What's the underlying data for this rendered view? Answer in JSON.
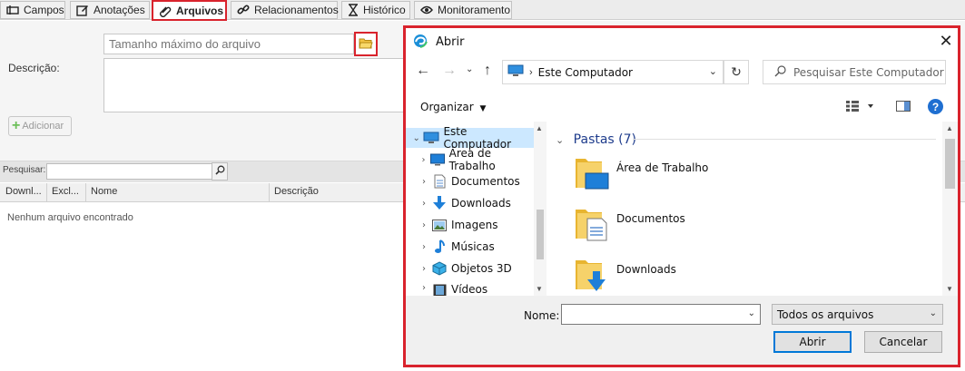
{
  "tabs": [
    {
      "label": "Campos",
      "icon": "field-icon"
    },
    {
      "label": "Anotações",
      "icon": "edit-note-icon"
    },
    {
      "label": "Arquivos",
      "icon": "paperclip-icon",
      "active": true
    },
    {
      "label": "Relacionamentos",
      "icon": "link-icon"
    },
    {
      "label": "Histórico",
      "icon": "hourglass-icon"
    },
    {
      "label": "Monitoramento",
      "icon": "eye-icon"
    }
  ],
  "form": {
    "file_placeholder": "Tamanho máximo do arquivo",
    "description_label": "Descrição:",
    "add_label": "Adicionar"
  },
  "grid": {
    "search_label": "Pesquisar:",
    "columns": [
      "Downl...",
      "Excl...",
      "Nome",
      "Descrição"
    ],
    "empty_message": "Nenhum arquivo encontrado"
  },
  "dialog": {
    "title": "Abrir",
    "close_symbol": "✕",
    "address": "Este Computador",
    "search_placeholder": "Pesquisar Este Computador",
    "organize_label": "Organizar",
    "nav_items": [
      {
        "label": "Este Computador",
        "icon": "computer-icon",
        "expanded": true,
        "selected": true
      },
      {
        "label": "Área de Trabalho",
        "icon": "desktop-icon"
      },
      {
        "label": "Documentos",
        "icon": "documents-icon"
      },
      {
        "label": "Downloads",
        "icon": "downloads-icon"
      },
      {
        "label": "Imagens",
        "icon": "pictures-icon"
      },
      {
        "label": "Músicas",
        "icon": "music-icon"
      },
      {
        "label": "Objetos 3D",
        "icon": "3d-objects-icon"
      },
      {
        "label": "Vídeos",
        "icon": "videos-icon"
      }
    ],
    "group_header": "Pastas (7)",
    "folders": [
      {
        "name": "Área de Trabalho",
        "icon": "desktop-folder-icon"
      },
      {
        "name": "Documentos",
        "icon": "documents-folder-icon"
      },
      {
        "name": "Downloads",
        "icon": "downloads-folder-icon"
      }
    ],
    "name_label": "Nome:",
    "name_value": "",
    "filter_value": "Todos os arquivos",
    "open_label": "Abrir",
    "cancel_label": "Cancelar"
  },
  "colors": {
    "highlight": "#d9232d",
    "accent": "#0078d7",
    "selection": "#cce8ff",
    "group_header": "#1e3c8c"
  }
}
